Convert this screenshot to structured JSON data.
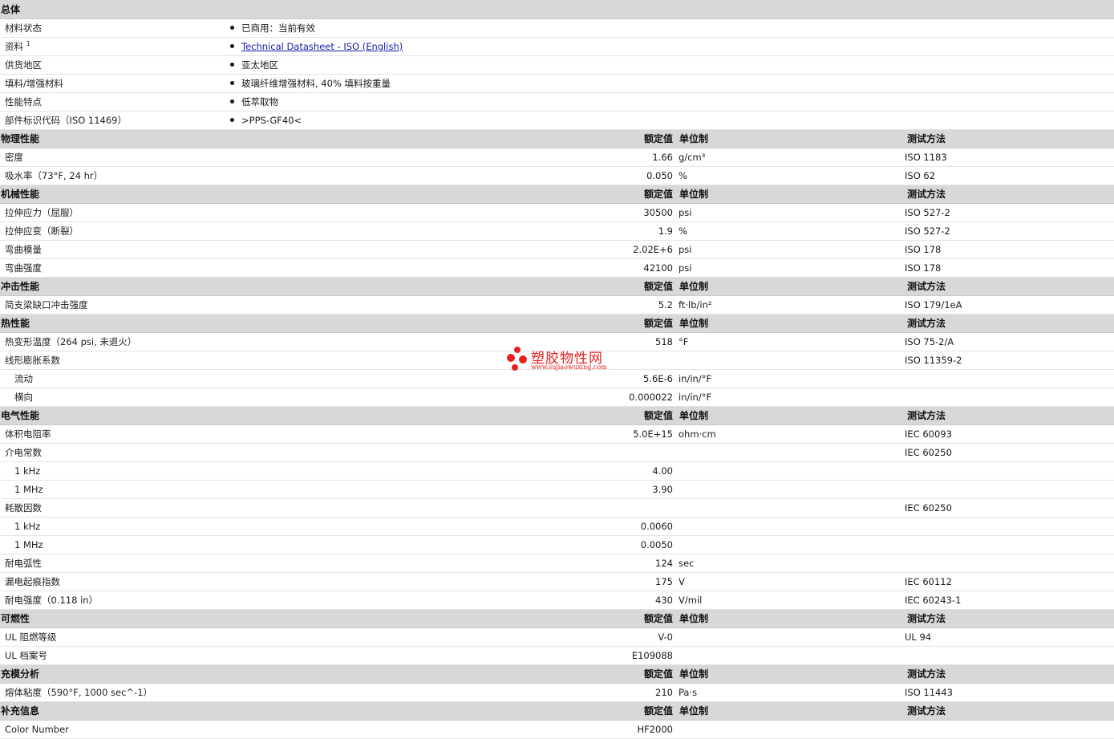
{
  "general": {
    "title": "总体",
    "rows": [
      {
        "label": "材料状态",
        "value": "已商用：当前有效"
      },
      {
        "label": "资料",
        "sup": "1",
        "link": "Technical Datasheet - ISO (English)"
      },
      {
        "label": "供货地区",
        "value": "亚太地区"
      },
      {
        "label": "填料/增强材料",
        "value": "玻璃纤维增强材料, 40% 填料按重量"
      },
      {
        "label": "性能特点",
        "value": "低萃取物"
      },
      {
        "label": "部件标识代码（ISO 11469）",
        "value": ">PPS-GF40<"
      }
    ]
  },
  "headers": {
    "nominal": "额定值",
    "unit": "单位制",
    "test": "测试方法"
  },
  "sections": [
    {
      "title": "物理性能",
      "rows": [
        {
          "label": "密度",
          "value": "1.66",
          "unit": "g/cm³",
          "test": "ISO 1183"
        },
        {
          "label": "吸水率（73°F, 24 hr）",
          "value": "0.050",
          "unit": "%",
          "test": "ISO 62"
        }
      ]
    },
    {
      "title": "机械性能",
      "rows": [
        {
          "label": "拉伸应力（屈服）",
          "value": "30500",
          "unit": "psi",
          "test": "ISO 527-2"
        },
        {
          "label": "拉伸应变（断裂）",
          "value": "1.9",
          "unit": "%",
          "test": "ISO 527-2"
        },
        {
          "label": "弯曲模量",
          "value": "2.02E+6",
          "unit": "psi",
          "test": "ISO 178"
        },
        {
          "label": "弯曲强度",
          "value": "42100",
          "unit": "psi",
          "test": "ISO 178"
        }
      ]
    },
    {
      "title": "冲击性能",
      "rows": [
        {
          "label": "简支梁缺口冲击强度",
          "value": "5.2",
          "unit": "ft·lb/in²",
          "test": "ISO 179/1eA"
        }
      ]
    },
    {
      "title": "热性能",
      "rows": [
        {
          "label": "热变形温度（264 psi, 未退火）",
          "value": "518",
          "unit": "°F",
          "test": "ISO 75-2/A"
        },
        {
          "label": "线形膨胀系数",
          "value": "",
          "unit": "",
          "test": "ISO 11359-2"
        },
        {
          "label": "流动",
          "sub": true,
          "value": "5.6E-6",
          "unit": "in/in/°F",
          "test": ""
        },
        {
          "label": "横向",
          "sub": true,
          "value": "0.000022",
          "unit": "in/in/°F",
          "test": ""
        }
      ]
    },
    {
      "title": "电气性能",
      "rows": [
        {
          "label": "体积电阻率",
          "value": "5.0E+15",
          "unit": "ohm·cm",
          "test": "IEC 60093"
        },
        {
          "label": "介电常数",
          "value": "",
          "unit": "",
          "test": "IEC 60250"
        },
        {
          "label": "1 kHz",
          "sub": true,
          "value": "4.00",
          "unit": "",
          "test": ""
        },
        {
          "label": "1 MHz",
          "sub": true,
          "value": "3.90",
          "unit": "",
          "test": ""
        },
        {
          "label": "耗散因数",
          "value": "",
          "unit": "",
          "test": "IEC 60250"
        },
        {
          "label": "1 kHz",
          "sub": true,
          "value": "0.0060",
          "unit": "",
          "test": ""
        },
        {
          "label": "1 MHz",
          "sub": true,
          "value": "0.0050",
          "unit": "",
          "test": ""
        },
        {
          "label": "耐电弧性",
          "value": "124",
          "unit": "sec",
          "test": ""
        },
        {
          "label": "漏电起痕指数",
          "value": "175",
          "unit": "V",
          "test": "IEC 60112"
        },
        {
          "label": "耐电强度（0.118 in）",
          "value": "430",
          "unit": "V/mil",
          "test": "IEC 60243-1"
        }
      ]
    },
    {
      "title": "可燃性",
      "rows": [
        {
          "label": "UL 阻燃等级",
          "value": "V-0",
          "unit": "",
          "test": "UL 94"
        },
        {
          "label": "UL 档案号",
          "value": "E109088",
          "unit": "",
          "test": ""
        }
      ]
    },
    {
      "title": "充模分析",
      "rows": [
        {
          "label": "熔体粘度（590°F, 1000 sec^-1）",
          "value": "210",
          "unit": "Pa·s",
          "test": "ISO 11443"
        }
      ]
    },
    {
      "title": "补充信息",
      "rows": [
        {
          "label": "Color Number",
          "value": "HF2000",
          "unit": "",
          "test": ""
        }
      ]
    }
  ],
  "watermark": {
    "title": "塑胶物性网",
    "url": "www.sujiaowuxing.com",
    "color": "#e62020"
  }
}
